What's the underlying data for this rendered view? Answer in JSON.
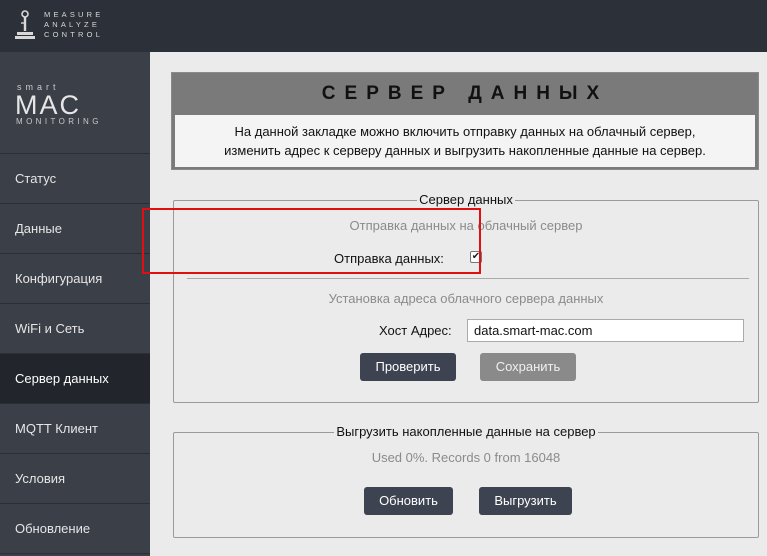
{
  "topbar": {
    "logo_lines": [
      "MEASURE",
      "ANALYZE",
      "CONTROL"
    ]
  },
  "sidebar": {
    "brand_smart": "smart",
    "brand_mac": "MAC",
    "brand_monitoring": "MONITORING",
    "items": [
      {
        "label": "Статус"
      },
      {
        "label": "Данные"
      },
      {
        "label": "Конфигурация"
      },
      {
        "label": "WiFi и Сеть"
      },
      {
        "label": "Сервер данных"
      },
      {
        "label": "MQTT Клиент"
      },
      {
        "label": "Условия"
      },
      {
        "label": "Обновление"
      }
    ]
  },
  "header": {
    "title": "СЕРВЕР ДАННЫХ",
    "desc_line1": "На данной закладке можно включить отправку данных на облачный сервер,",
    "desc_line2": "изменить адрес к серверу данных и выгрузить накопленные данные на сервер."
  },
  "server": {
    "legend": "Сервер данных",
    "send_title": "Отправка данных на облачный сервер",
    "send_label": "Отправка данных:",
    "send_checked": "✔",
    "addr_title": "Установка адреса облачного сервера данных",
    "host_label": "Хост Адрес:",
    "host_value": "data.smart-mac.com",
    "check_button": "Проверить",
    "save_button": "Сохранить"
  },
  "upload": {
    "legend": "Выгрузить накопленные данные на сервер",
    "status": "Used 0%. Records 0 from 16048",
    "refresh_button": "Обновить",
    "upload_button": "Выгрузить"
  }
}
